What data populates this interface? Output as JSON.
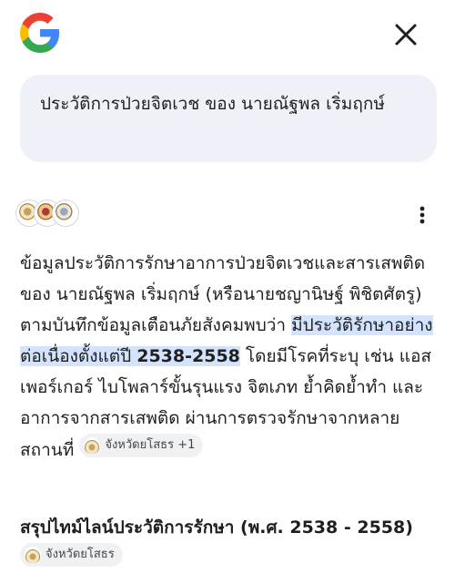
{
  "header": {
    "logo_icon": "google-g-logo-icon",
    "close_icon": "close-icon"
  },
  "query": {
    "text": "ประวัติการป่วยจิตเวช ของ นายณัฐพล เริ่มฤกษ์"
  },
  "sources": {
    "icons": [
      "seal-icon",
      "seal-icon",
      "seal-icon"
    ],
    "menu_icon": "more-vert-icon"
  },
  "answer": {
    "part1": "ข้อมูลประวัติการรักษาอาการป่วยจิตเวชและสารเสพติดของ นายณัฐพล เริ่มฤกษ์ (หรือนายชญานิษฐ์ พิชิตศัตรู) ตามบันทึกข้อมูลเตือนภัยสังคมพบว่า ",
    "highlight_text": "มีประวัติรักษาอย่างต่อเนื่องตั้งแต่ปี ",
    "highlight_years": "2538-2558",
    "part2": " โดยมีโรคที่ระบุ เช่น แอสเพอร์เกอร์ ไบโพลาร์ขั้นรุนแรง จิตเภท ย้ำคิดย้ำทำ และอาการจากสารเสพติด ผ่านการตรวจรักษาจากหลายสถานที่ ",
    "chip_label": "จังหวัดยโสธร +1"
  },
  "section": {
    "title": "สรุปไทม์ไลน์ประวัติการรักษา (พ.ศ. 2538 - 2558) ",
    "chip_label": "จังหวัดยโสธร"
  },
  "colors": {
    "highlight": "#d3e3fd",
    "query_bg": "#eef2f8",
    "chip_bg": "#f0f1f3"
  }
}
